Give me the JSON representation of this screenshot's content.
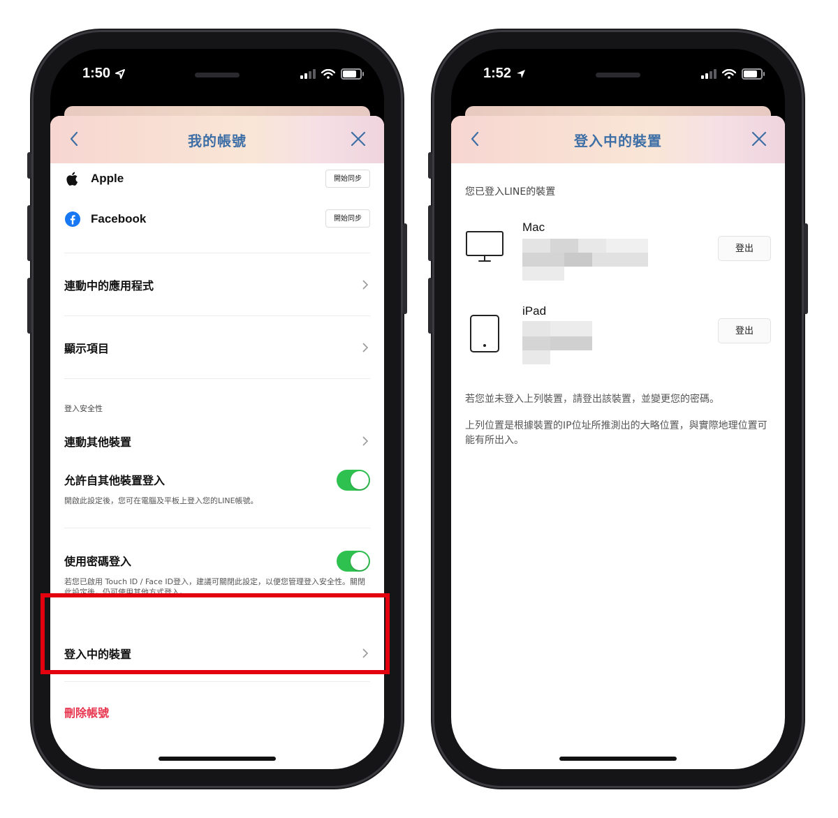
{
  "left": {
    "status": {
      "time": "1:50"
    },
    "header": {
      "title": "我的帳號"
    },
    "sync": [
      {
        "label": "Apple",
        "button": "開始同步",
        "icon": "apple-logo-icon"
      },
      {
        "label": "Facebook",
        "button": "開始同步",
        "icon": "facebook-logo-icon"
      }
    ],
    "linked_apps": "連動中的應用程式",
    "display_items": "顯示項目",
    "security": {
      "section_title": "登入安全性",
      "link_devices": "連動其他裝置",
      "allow_login": {
        "label": "允許自其他裝置登入",
        "desc": "開啟此設定後，您可在電腦及平板上登入您的LINE帳號。",
        "on": true
      },
      "password_login": {
        "label": "使用密碼登入",
        "desc": "若您已啟用 Touch ID / Face ID登入，建議可關閉此設定，以便您管理登入安全性。關閉此設定後，仍可使用其他方式登入。",
        "on": true
      }
    },
    "logged_in_devices": "登入中的裝置",
    "delete_account": "刪除帳號"
  },
  "right": {
    "status": {
      "time": "1:52"
    },
    "header": {
      "title": "登入中的裝置"
    },
    "intro": "您已登入LINE的裝置",
    "devices": [
      {
        "name": "Mac",
        "button": "登出",
        "icon": "monitor-icon"
      },
      {
        "name": "iPad",
        "button": "登出",
        "icon": "tablet-icon"
      }
    ],
    "note1": "若您並未登入上列裝置，請登出該裝置，並變更您的密碼。",
    "note2": "上列位置是根據裝置的IP位址所推測出的大略位置，與實際地理位置可能有所出入。"
  },
  "colors": {
    "accent_title": "#3d6fa6",
    "toggle_on": "#2fc14f",
    "danger": "#e8334d",
    "highlight": "#e3000f"
  }
}
